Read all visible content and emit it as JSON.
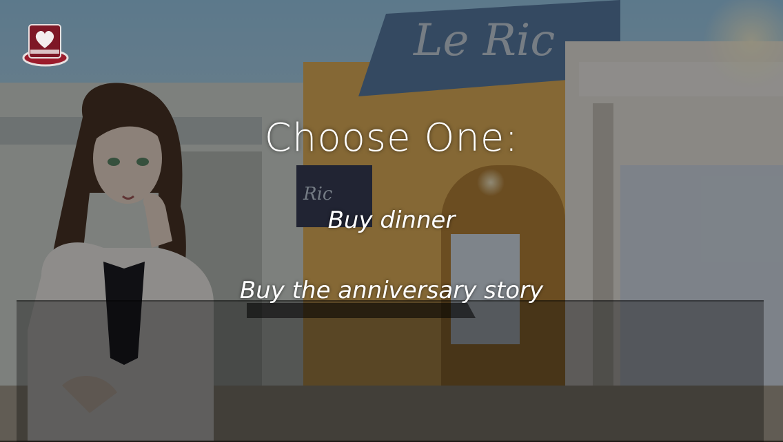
{
  "menu": {
    "title": "Choose One:"
  },
  "choices": [
    {
      "label": "Buy dinner"
    },
    {
      "label": "Buy the anniversary story"
    }
  ],
  "icons": {
    "menu": "heart-tophat-icon"
  },
  "colors": {
    "text": "#ffffff",
    "overlay": "#000000",
    "icon_red": "#9b1c2c"
  }
}
